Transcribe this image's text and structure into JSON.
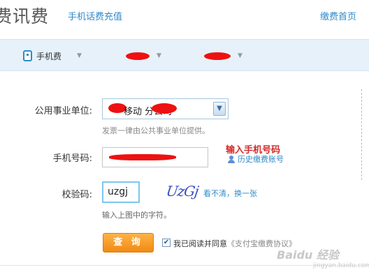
{
  "header": {
    "title": "费讯费",
    "recharge_link": "手机话费充值",
    "home_link": "缴费首页"
  },
  "toolbar": {
    "items": [
      {
        "label": "手机费",
        "arrow": "▼"
      },
      {
        "label": "",
        "arrow": "▼"
      },
      {
        "label": "",
        "arrow": "▼"
      }
    ]
  },
  "form": {
    "unit": {
      "label": "公用事业单位:",
      "value": "移动    分公司",
      "dropdown_glyph": "▼",
      "hint": "发票一律由公共事业单位提供。"
    },
    "phone": {
      "label": "手机号码:",
      "value": "",
      "annotation": "输入手机号码",
      "history_link": "历史缴费账号"
    },
    "captcha": {
      "label": "校验码:",
      "value": "uzgj",
      "image_text": "UzGj",
      "refresh_link": "看不清，换一张",
      "hint": "输入上图中的字符。"
    },
    "submit_label": "查 询",
    "agreement": {
      "checked": true,
      "check_glyph": "✔",
      "text": "我已阅读并同意",
      "link": "《支付宝缴费协议》"
    }
  },
  "watermark": {
    "brand": "Baidu 经验",
    "sub": "jingyan.baidu.com"
  },
  "colors": {
    "link": "#2f8ac9",
    "toolbar_bg": "#e6f1fa",
    "annotation": "#d42a2a",
    "button": "#f08a12",
    "redaction": "#ee1111"
  }
}
